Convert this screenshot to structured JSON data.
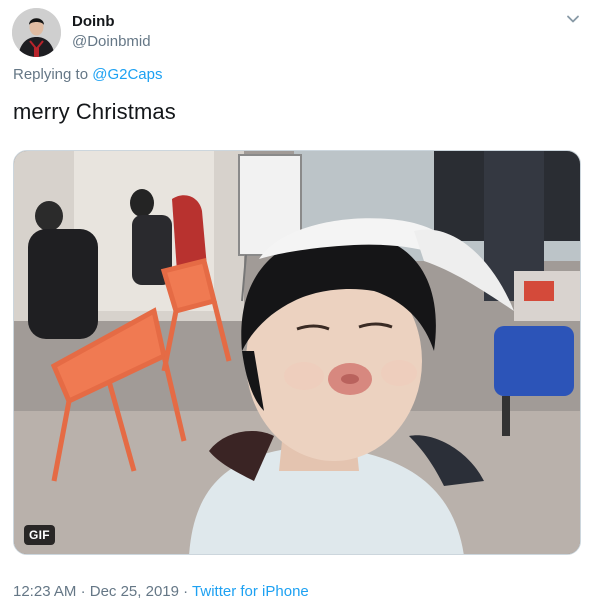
{
  "tweet": {
    "display_name": "Doinb",
    "handle": "@Doinbmid",
    "more_icon": "chevron-down-icon",
    "reply_prefix": "Replying to",
    "reply_to": "@G2Caps",
    "text": "merry Christmas",
    "media": {
      "type": "gif",
      "badge": "GIF"
    },
    "time": "12:23 AM",
    "separator_1": "·",
    "date": "Dec 25, 2019",
    "separator_2": "·",
    "source": "Twitter for iPhone"
  },
  "colors": {
    "text": "#14171a",
    "secondary": "#657786",
    "link": "#1da1f2"
  }
}
